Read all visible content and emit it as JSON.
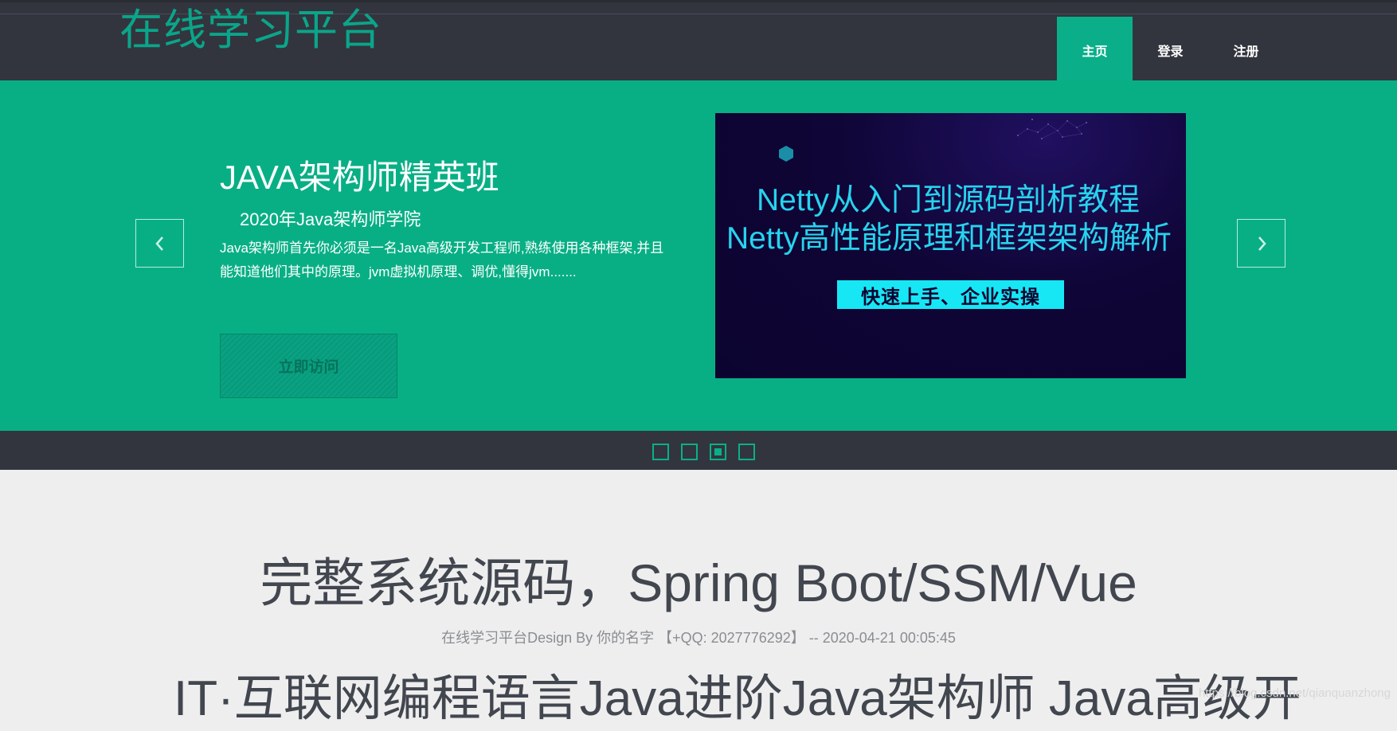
{
  "header": {
    "logo": "在线学习平台",
    "nav": [
      {
        "label": "主页",
        "active": true
      },
      {
        "label": "登录",
        "active": false
      },
      {
        "label": "注册",
        "active": false
      }
    ]
  },
  "banner": {
    "slide": {
      "title": "JAVA架构师精英班",
      "subtitle": "2020年Java架构师学院",
      "description": "Java架构师首先你必须是一名Java高级开发工程师,熟练使用各种框架,并且能知道他们其中的原理。jvm虚拟机原理、调优,懂得jvm.......",
      "button_label": "立即访问",
      "image": {
        "line1": "Netty从入门到源码剖析教程",
        "line2": "Netty高性能原理和框架架构解析",
        "tagline": "快速上手、企业实操"
      }
    },
    "prev_icon": "chevron-left-icon",
    "next_icon": "chevron-right-icon",
    "indicators": {
      "count": 4,
      "active_index": 2
    }
  },
  "content": {
    "title": "完整系统源码，Spring Boot/SSM/Vue",
    "meta": "在线学习平台Design By 你的名字 【+QQ: 2027776292】 -- 2020-04-21 00:05:45",
    "heading2": "IT·互联网编程语言Java进阶Java架构师 Java高级开"
  },
  "watermark": "https://blog.csdn.net/qianquanzhong",
  "colors": {
    "accent": "#0aaf89",
    "header_bg": "#32353d",
    "banner_bg": "#08af85",
    "page_bg": "#eeeeee",
    "image_text": "#27d3ee",
    "tagline_bg": "#17e7f5"
  }
}
